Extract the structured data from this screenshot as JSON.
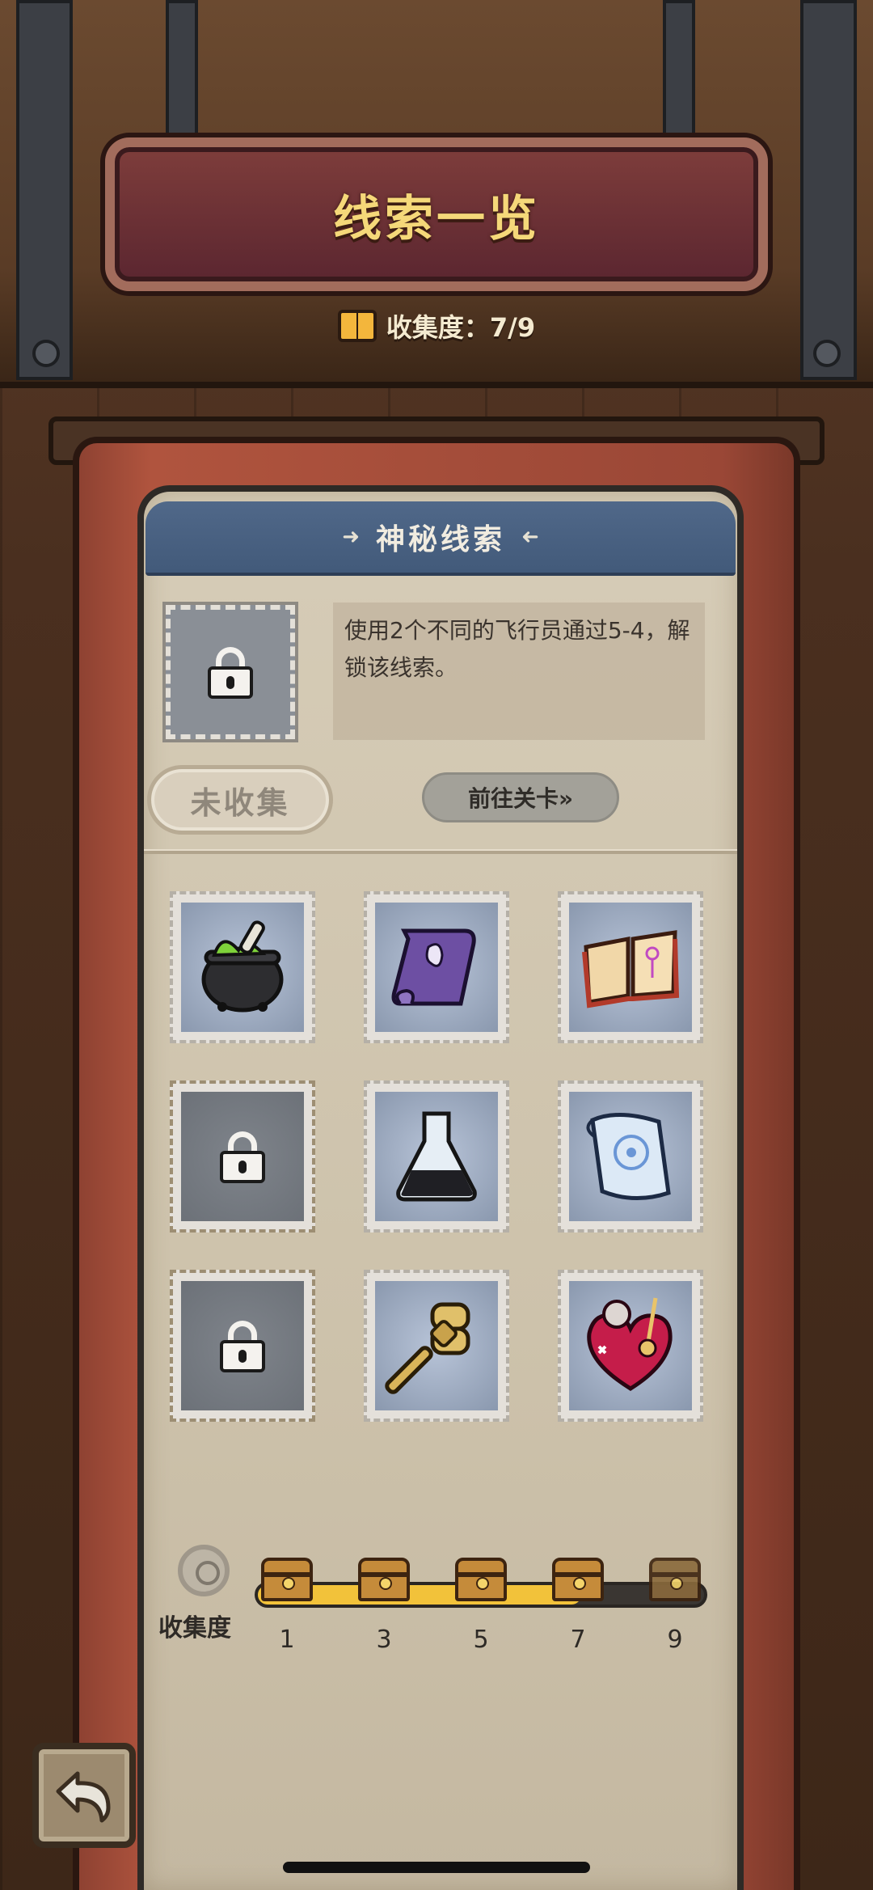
{
  "header": {
    "title": "线索一览",
    "progress_label": "收集度：7/9"
  },
  "detail": {
    "panel_title": "神秘线索",
    "description": "使用2个不同的飞行员通过5-4，解锁该线索。",
    "status": "未收集",
    "goto_label": "前往关卡»"
  },
  "clues": [
    {
      "icon": "cauldron-icon",
      "locked": false
    },
    {
      "icon": "purple-scroll-icon",
      "locked": false
    },
    {
      "icon": "open-book-icon",
      "locked": false
    },
    {
      "icon": "lock-icon",
      "locked": true
    },
    {
      "icon": "flask-icon",
      "locked": false
    },
    {
      "icon": "blue-map-icon",
      "locked": false
    },
    {
      "icon": "lock-icon",
      "locked": true
    },
    {
      "icon": "windup-key-icon",
      "locked": false
    },
    {
      "icon": "heart-pincushion-icon",
      "locked": false
    }
  ],
  "collection": {
    "label": "收集度",
    "collected": 7,
    "total": 9,
    "milestones": [
      "1",
      "3",
      "5",
      "7",
      "9"
    ]
  },
  "colors": {
    "accent_gold": "#f2c23a",
    "title_gold": "#f5d879",
    "panel_head": "#506889"
  }
}
